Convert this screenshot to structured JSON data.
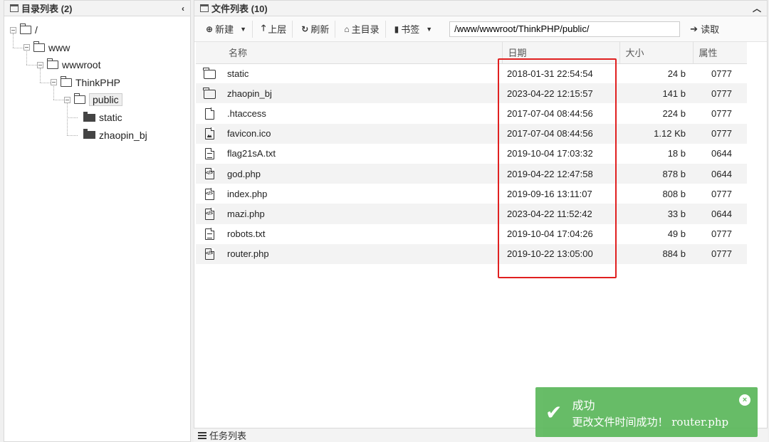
{
  "left_panel": {
    "title": "目录列表 (2)",
    "collapse_glyph": "‹",
    "tree": [
      {
        "label": "/",
        "depth": 0,
        "style": "outline"
      },
      {
        "label": "www",
        "depth": 1,
        "style": "outline"
      },
      {
        "label": "wwwroot",
        "depth": 2,
        "style": "outline"
      },
      {
        "label": "ThinkPHP",
        "depth": 3,
        "style": "outline"
      },
      {
        "label": "public",
        "depth": 4,
        "style": "outline",
        "selected": true
      },
      {
        "label": "static",
        "depth": 5,
        "style": "solid"
      },
      {
        "label": "zhaopin_bj",
        "depth": 5,
        "style": "solid"
      }
    ]
  },
  "right_panel": {
    "title": "文件列表 (10)",
    "collapse_glyph": "︿",
    "toolbar": {
      "new_label": "新建",
      "up_label": "上层",
      "refresh_label": "刷新",
      "home_label": "主目录",
      "bookmark_label": "书签",
      "path_value": "/www/wwwroot/ThinkPHP/public/",
      "read_label": "读取"
    },
    "columns": [
      "名称",
      "日期",
      "大小",
      "属性"
    ],
    "files": [
      {
        "icon": "folder",
        "name": "static",
        "date": "2018-01-31 22:54:54",
        "size": "24 b",
        "perm": "0777"
      },
      {
        "icon": "folder",
        "name": "zhaopin_bj",
        "date": "2023-04-22 12:15:57",
        "size": "141 b",
        "perm": "0777"
      },
      {
        "icon": "file",
        "name": ".htaccess",
        "date": "2017-07-04 08:44:56",
        "size": "224 b",
        "perm": "0777"
      },
      {
        "icon": "image",
        "name": "favicon.ico",
        "date": "2017-07-04 08:44:56",
        "size": "1.12 Kb",
        "perm": "0777"
      },
      {
        "icon": "text",
        "name": "flag21sA.txt",
        "date": "2019-10-04 17:03:32",
        "size": "18 b",
        "perm": "0644"
      },
      {
        "icon": "code",
        "name": "god.php",
        "date": "2019-04-22 12:47:58",
        "size": "878 b",
        "perm": "0644"
      },
      {
        "icon": "code",
        "name": "index.php",
        "date": "2019-09-16 13:11:07",
        "size": "808 b",
        "perm": "0777"
      },
      {
        "icon": "code",
        "name": "mazi.php",
        "date": "2023-04-22 11:52:42",
        "size": "33 b",
        "perm": "0644"
      },
      {
        "icon": "text",
        "name": "robots.txt",
        "date": "2019-10-04 17:04:26",
        "size": "49 b",
        "perm": "0777"
      },
      {
        "icon": "code",
        "name": "router.php",
        "date": "2019-10-22 13:05:00",
        "size": "884 b",
        "perm": "0777"
      }
    ]
  },
  "task_bar": {
    "label": "任务列表"
  },
  "toast": {
    "title": "成功",
    "message": "更改文件时间成功！ router.php",
    "close_glyph": "×",
    "check_glyph": "✔"
  },
  "colors": {
    "toast_bg": "#5cb85c",
    "highlight_box": "#e02020"
  }
}
